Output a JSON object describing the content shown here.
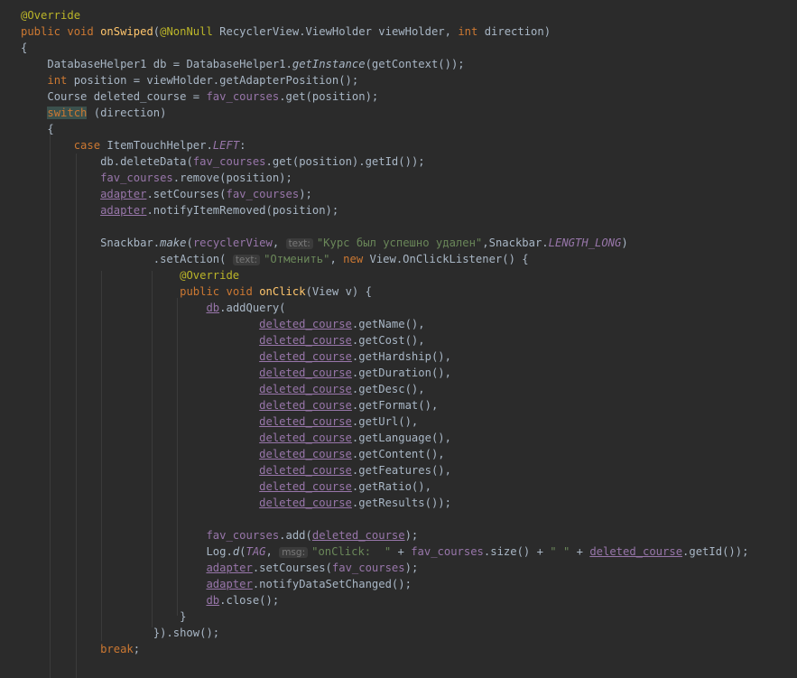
{
  "tokens": {
    "override": "@Override",
    "nonnull": "@NonNull",
    "public": "public",
    "void": "void",
    "int": "int",
    "new": "new",
    "switch": "switch",
    "case": "case",
    "break": "break",
    "onSwiped": "onSwiped",
    "onClick": "onClick",
    "viewHolderType": "RecyclerView.ViewHolder viewHolder,",
    "direction": "direction)",
    "brace_open": "{",
    "brace_close": "}",
    "dbhelper_decl": "DatabaseHelper1 db = DatabaseHelper1.",
    "getInstance": "getInstance",
    "getContext": "(getContext());",
    "position_decl": "position = viewHolder.getAdapterPosition();",
    "course_decl": "Course deleted_course = ",
    "fav_courses": "fav_courses",
    "get_position": ".get(position);",
    "switch_arg": "(direction)",
    "case_lhs": "ItemTouchHelper.",
    "LEFT": "LEFT",
    "colon": ":",
    "delete_call": "db.deleteData(",
    "get_pos_id": ".get(position).getId());",
    "remove_call": ".remove(position);",
    "adapter": "adapter",
    "setCourses": ".setCourses(",
    "close_paren_semi": ");",
    "notify_removed": ".notifyItemRemoved(position);",
    "snackbar_make": "Snackbar.",
    "make": "make",
    "recyclerView": "recyclerView",
    "comma": ",",
    "hint_text": "text:",
    "snackbar_msg": "\"Курс был успешно удален\"",
    "snackbar_len_prefix": ",Snackbar.",
    "LENGTH_LONG": "LENGTH_LONG",
    "paren_close": ")",
    "set_action": ".setAction(",
    "action_msg": "\"Отменить\"",
    "onclick_listener": "View.OnClickListener() {",
    "view_v": "(View v) {",
    "db": "db",
    "add_query": ".addQuery(",
    "deleted_course": "deleted_course",
    "get_name": ".getName(),",
    "get_cost": ".getCost(),",
    "get_hardship": ".getHardship(),",
    "get_duration": ".getDuration(),",
    "get_desc": ".getDesc(),",
    "get_format": ".getFormat(),",
    "get_url": ".getUrl(),",
    "get_language": ".getLanguage(),",
    "get_content": ".getContent(),",
    "get_features": ".getFeatures(),",
    "get_ratio": ".getRatio(),",
    "get_results": ".getResults());",
    "add_call": ".add(",
    "log_d": "Log.",
    "d": "d",
    "open_paren": "(",
    "TAG": "TAG",
    "hint_msg": "msg:",
    "onclick_str": "\"onClick:  \"",
    "plus": " + ",
    "size_call": ".size() + ",
    "space_str": "\" \"",
    "get_id_close": ".getId());",
    "notify_changed": ".notifyDataSetChanged();",
    "close_call": ".close();",
    "show_call": "}).show();"
  }
}
